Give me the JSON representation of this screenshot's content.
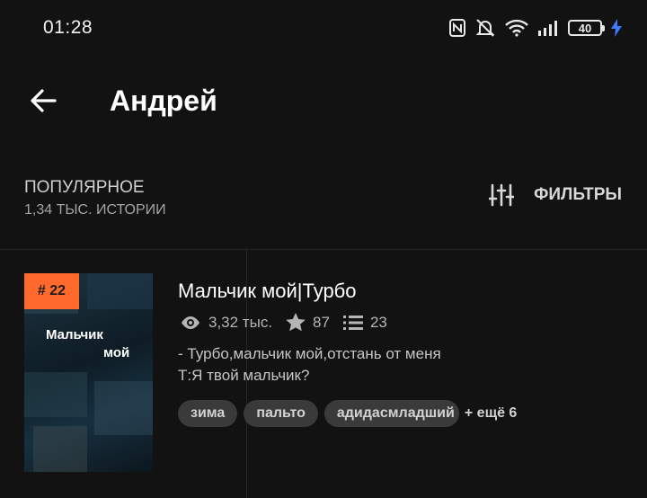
{
  "status_bar": {
    "time": "01:28",
    "battery": "40",
    "icons": [
      "nfc-icon",
      "mute-icon",
      "wifi-icon",
      "signal-icon",
      "battery-icon",
      "charging-icon"
    ],
    "charging_color": "#3d7bff"
  },
  "header": {
    "title": "Андрей",
    "back_icon": "arrow-left-icon"
  },
  "section": {
    "sort_label": "ПОПУЛЯРНОЕ",
    "count_label": "1,34 ТЫС. ИСТОРИИ",
    "filters_label": "ФИЛЬТРЫ",
    "filters_icon": "sliders-icon"
  },
  "stories": [
    {
      "rank": "# 22",
      "cover_title_line1": "Мальчик",
      "cover_title_line2": "мой",
      "title": "Мальчик мой|Турбо",
      "views": "3,32 тыс.",
      "votes": "87",
      "parts": "23",
      "description_line1": "- Турбо,мальчик мой,отстань от меня",
      "description_line2": "Т:Я твой мальчик?",
      "tags": [
        "зима",
        "пальто",
        "адидасмладший"
      ],
      "more_tags": "+ ещё 6"
    }
  ],
  "colors": {
    "background": "#121212",
    "rank_badge": "#ff6a2c",
    "tag_bg": "#3a3a3a"
  }
}
